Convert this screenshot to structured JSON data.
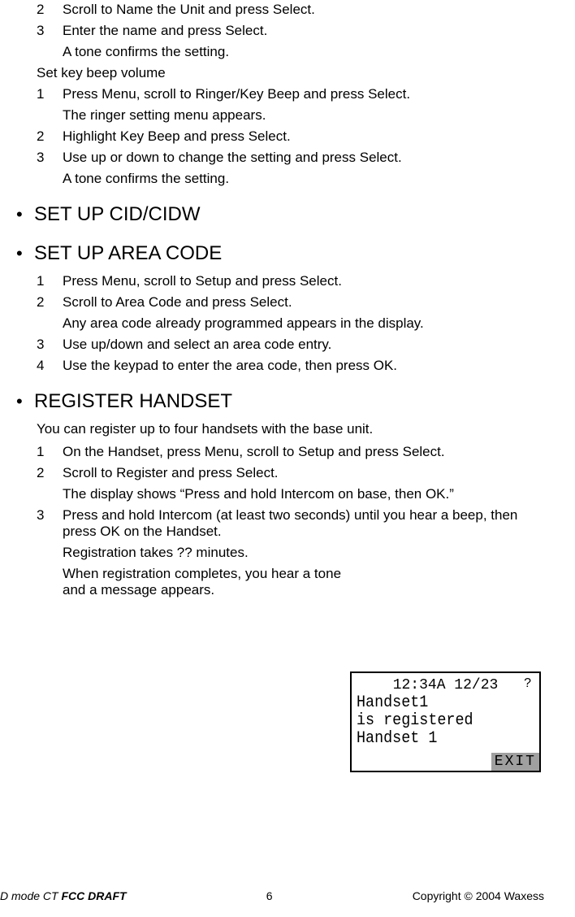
{
  "top_steps": [
    {
      "num": "2",
      "text": "Scroll to Name the Unit and press Select."
    },
    {
      "num": "3",
      "text": "Enter the name and press Select.",
      "note": "A tone confirms the setting."
    }
  ],
  "keybeep_head": "Set key beep volume",
  "keybeep_steps": [
    {
      "num": "1",
      "text": "Press Menu, scroll to Ringer/Key Beep and press Select.",
      "note": "The ringer setting menu appears."
    },
    {
      "num": "2",
      "text": "Highlight Key Beep and press Select."
    },
    {
      "num": "3",
      "text": "Use up or down to change the setting and press Select.",
      "note": "A tone confirms the setting."
    }
  ],
  "section_cid": "SET UP CID/CIDW",
  "section_area": "SET UP AREA CODE",
  "area_steps": [
    {
      "num": "1",
      "text": "Press Menu, scroll to Setup and press Select."
    },
    {
      "num": "2",
      "text": "Scroll to Area Code and press Select.",
      "note": "Any area code already programmed appears in the display."
    },
    {
      "num": "3",
      "text": "Use up/down and select an area code entry."
    },
    {
      "num": "4",
      "text": "Use the keypad to enter the area code, then press OK."
    }
  ],
  "section_reg": "REGISTER HANDSET",
  "reg_intro": "You can register up to four handsets with the base unit.",
  "reg_steps": [
    {
      "num": "1",
      "text": "On the Handset, press Menu, scroll to Setup and press Select."
    },
    {
      "num": "2",
      "text": "Scroll to Register and press Select.",
      "note": "The display shows “Press and hold Intercom on base, then OK.”"
    },
    {
      "num": "3",
      "text": "Press and hold Intercom (at least two seconds) until you hear a beep, then press OK on the Handset.",
      "note": "Registration takes ?? minutes."
    }
  ],
  "reg_complete": "When registration completes, you hear a tone and a message appears.",
  "lcd": {
    "time": "12:34A 12/23",
    "q": "?",
    "line1": "Handset1",
    "line2": "is registered",
    "line3": "Handset 1",
    "exit": "EXIT"
  },
  "footer": {
    "left_plain": "D mode CT ",
    "left_bold": "FCC DRAFT",
    "center": "6",
    "right": "Copyright © 2004 Waxess"
  },
  "bullet": "•"
}
